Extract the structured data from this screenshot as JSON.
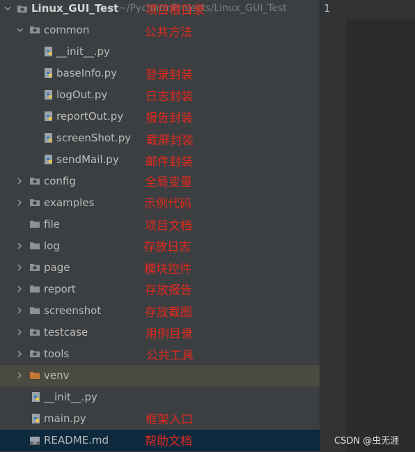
{
  "project": {
    "name": "Linux_GUI_Test",
    "path": "~/PycharmProjects/Linux_GUI_Test"
  },
  "tree": {
    "common": "common",
    "init_common": "__init__.py",
    "baseInfo": "baseInfo.py",
    "logOut": "logOut.py",
    "reportOut": "reportOut.py",
    "screenShot": "screenShot.py",
    "sendMail": "sendMail.py",
    "config": "config",
    "examples": "examples",
    "file": "file",
    "log": "log",
    "page": "page",
    "report": "report",
    "screenshot": "screenshot",
    "testcase": "testcase",
    "tools": "tools",
    "venv": "venv",
    "init_root": "__init__.py",
    "main": "main.py",
    "readme": "README.md"
  },
  "annotations": {
    "root": "项目根目录",
    "common": "公共方法",
    "baseInfo": "登录封装",
    "logOut": "日志封装",
    "reportOut": "报告封装",
    "screenShot": "截屏封装",
    "sendMail": "邮件封装",
    "config": "全局变量",
    "examples": "示例代码",
    "file": "项目文档",
    "log": "存放日志",
    "page": "模块控件",
    "report": "存放报告",
    "screenshot": "存放截图",
    "testcase": "用例目录",
    "tools": "公共工具",
    "main": "框架入口",
    "readme": "帮助文档"
  },
  "editor": {
    "line_number": "1"
  },
  "watermark": "CSDN @虫无涯",
  "colors": {
    "tree_bg": "#3c3f41",
    "editor_bg": "#2b2b2b",
    "annotation": "#e02a1e",
    "folder": "#8a9199",
    "venv_folder": "#c57633",
    "selected": "#0d293e"
  }
}
